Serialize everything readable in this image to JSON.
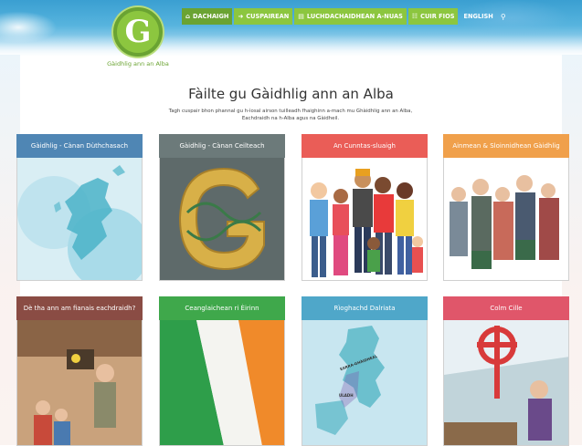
{
  "site": {
    "logo_letter": "G",
    "logo_text": "Gàidhlig ann an Alba"
  },
  "nav": {
    "items": [
      {
        "label": "DACHAIGH",
        "icon": "home-icon",
        "glyph": "⌂"
      },
      {
        "label": "CUSPAIREAN",
        "icon": "arrow-circle-icon",
        "glyph": "➜"
      },
      {
        "label": "LUCHDACHAIDHEAN A-NUAS",
        "icon": "document-icon",
        "glyph": "▤"
      },
      {
        "label": "CUIR FIOS",
        "icon": "contact-icon",
        "glyph": "☷"
      }
    ],
    "english": "ENGLISH",
    "search_glyph": "⚲"
  },
  "main": {
    "title": "Fàilte gu Gàidhlig ann an Alba",
    "subtitle_line1": "Tagh cuspair bhon phannal gu h-ìosal airson tuilleadh fhaighinn a-mach mu Ghàidhlig ann an Alba,",
    "subtitle_line2": "Eachdraidh na h-Alba agus na Gàidheil."
  },
  "cards": [
    {
      "label": "Gàidhlig - Cànan Dùthchasach",
      "color": "#4f86b4"
    },
    {
      "label": "Gàidhlig - Cànan Ceilteach",
      "color": "#6c7a7a"
    },
    {
      "label": "An Cunntas-sluaigh",
      "color": "#ea5d57"
    },
    {
      "label": "Ainmean & Sloinnidhean Gàidhlig",
      "color": "#f0a04b"
    },
    {
      "label": "Dè tha ann am fianais eachdraidh?",
      "color": "#8a4c44"
    },
    {
      "label": "Ceanglaichean ri Èirinn",
      "color": "#3fa84b"
    },
    {
      "label": "Rìoghachd Dalriata",
      "color": "#4fa7c9"
    },
    {
      "label": "Colm Cille",
      "color": "#e0566a"
    }
  ],
  "map_labels": {
    "dalriada": "EARRA-GHÀIDHEAL",
    "ulster": "ULADH"
  }
}
